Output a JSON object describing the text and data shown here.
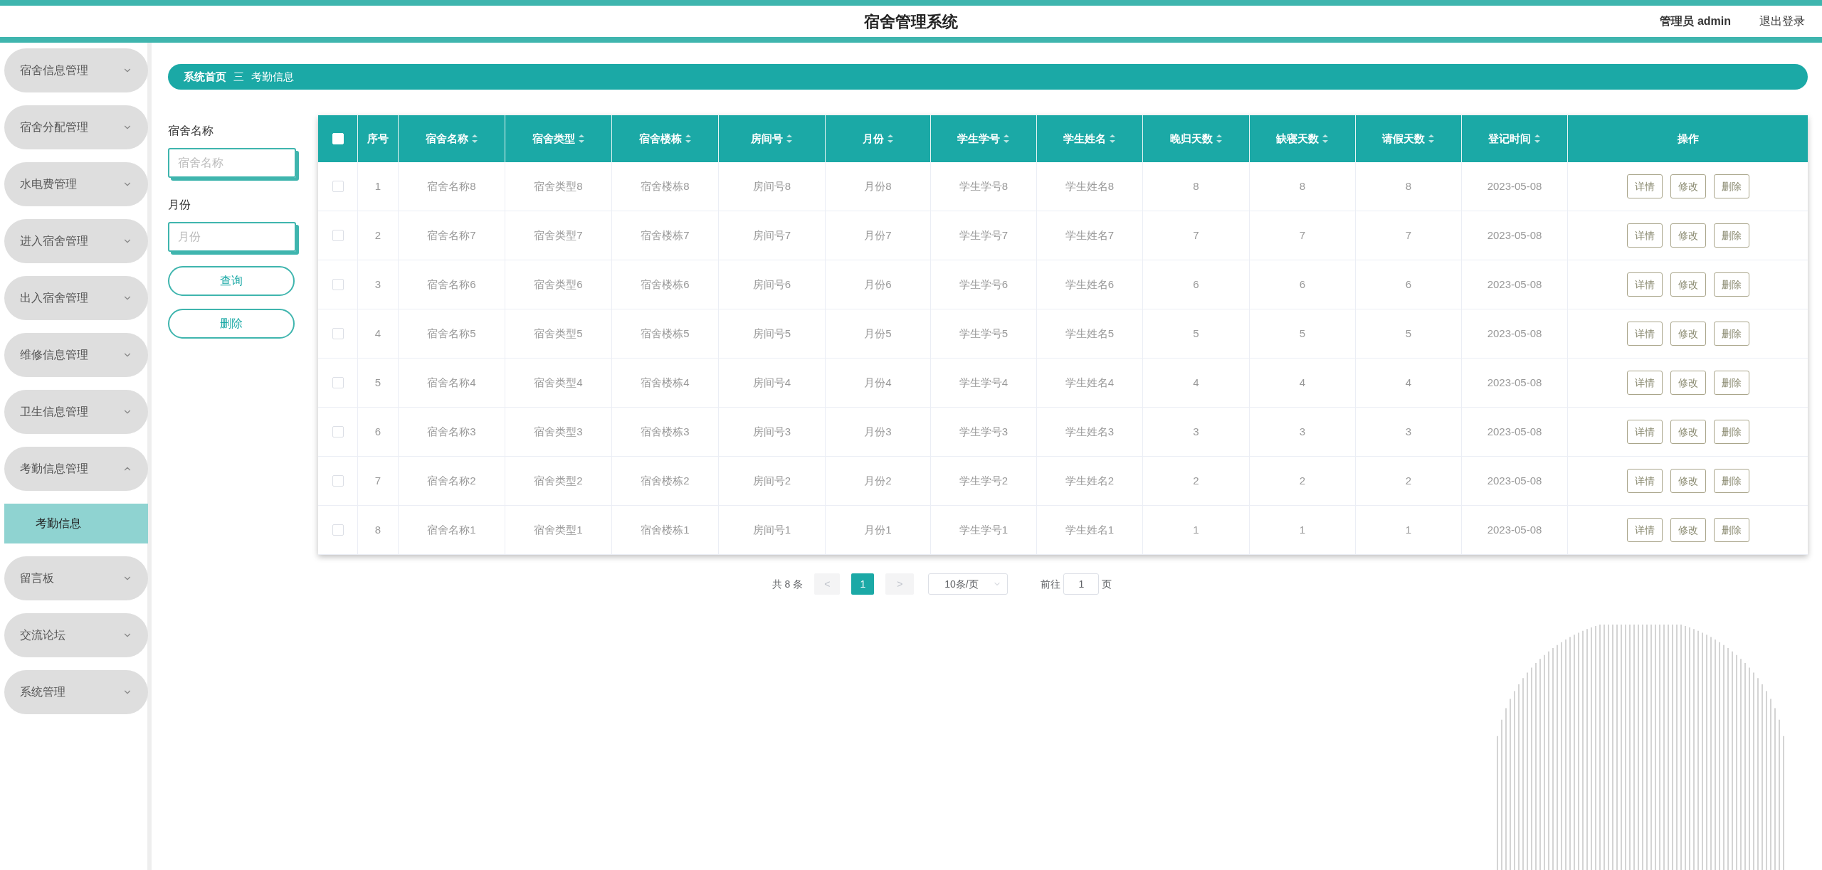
{
  "header": {
    "title": "宿舍管理系统",
    "user": "管理员 admin",
    "logout": "退出登录"
  },
  "sidebar": {
    "items": [
      {
        "label": "宿舍信息管理",
        "expanded": false
      },
      {
        "label": "宿舍分配管理",
        "expanded": false
      },
      {
        "label": "水电费管理",
        "expanded": false
      },
      {
        "label": "进入宿舍管理",
        "expanded": false
      },
      {
        "label": "出入宿舍管理",
        "expanded": false
      },
      {
        "label": "维修信息管理",
        "expanded": false
      },
      {
        "label": "卫生信息管理",
        "expanded": false
      },
      {
        "label": "考勤信息管理",
        "expanded": true,
        "children": [
          {
            "label": "考勤信息",
            "selected": true
          }
        ]
      },
      {
        "label": "留言板",
        "expanded": false
      },
      {
        "label": "交流论坛",
        "expanded": false
      },
      {
        "label": "系统管理",
        "expanded": false
      }
    ]
  },
  "breadcrumb": [
    "系统首页",
    "考勤信息"
  ],
  "breadcrumb_separator": "三",
  "search": {
    "fields": [
      {
        "label": "宿舍名称",
        "placeholder": "宿舍名称"
      },
      {
        "label": "月份",
        "placeholder": "月份"
      }
    ],
    "buttons": [
      "查询",
      "删除"
    ]
  },
  "table": {
    "select_all_checked": false,
    "columns": [
      {
        "label": "序号",
        "sortable": false
      },
      {
        "label": "宿舍名称",
        "sortable": true
      },
      {
        "label": "宿舍类型",
        "sortable": true
      },
      {
        "label": "宿舍楼栋",
        "sortable": true
      },
      {
        "label": "房间号",
        "sortable": true
      },
      {
        "label": "月份",
        "sortable": true
      },
      {
        "label": "学生学号",
        "sortable": true
      },
      {
        "label": "学生姓名",
        "sortable": true
      },
      {
        "label": "晚归天数",
        "sortable": true
      },
      {
        "label": "缺寝天数",
        "sortable": true
      },
      {
        "label": "请假天数",
        "sortable": true
      },
      {
        "label": "登记时间",
        "sortable": true
      },
      {
        "label": "操作",
        "sortable": false
      }
    ],
    "rows": [
      {
        "checked": false,
        "cells": [
          "1",
          "宿舍名称8",
          "宿舍类型8",
          "宿舍楼栋8",
          "房间号8",
          "月份8",
          "学生学号8",
          "学生姓名8",
          "8",
          "8",
          "8",
          "2023-05-08"
        ],
        "actions": [
          "详情",
          "修改",
          "删除"
        ]
      },
      {
        "checked": false,
        "cells": [
          "2",
          "宿舍名称7",
          "宿舍类型7",
          "宿舍楼栋7",
          "房间号7",
          "月份7",
          "学生学号7",
          "学生姓名7",
          "7",
          "7",
          "7",
          "2023-05-08"
        ],
        "actions": [
          "详情",
          "修改",
          "删除"
        ]
      },
      {
        "checked": false,
        "cells": [
          "3",
          "宿舍名称6",
          "宿舍类型6",
          "宿舍楼栋6",
          "房间号6",
          "月份6",
          "学生学号6",
          "学生姓名6",
          "6",
          "6",
          "6",
          "2023-05-08"
        ],
        "actions": [
          "详情",
          "修改",
          "删除"
        ]
      },
      {
        "checked": false,
        "cells": [
          "4",
          "宿舍名称5",
          "宿舍类型5",
          "宿舍楼栋5",
          "房间号5",
          "月份5",
          "学生学号5",
          "学生姓名5",
          "5",
          "5",
          "5",
          "2023-05-08"
        ],
        "actions": [
          "详情",
          "修改",
          "删除"
        ]
      },
      {
        "checked": false,
        "cells": [
          "5",
          "宿舍名称4",
          "宿舍类型4",
          "宿舍楼栋4",
          "房间号4",
          "月份4",
          "学生学号4",
          "学生姓名4",
          "4",
          "4",
          "4",
          "2023-05-08"
        ],
        "actions": [
          "详情",
          "修改",
          "删除"
        ]
      },
      {
        "checked": false,
        "cells": [
          "6",
          "宿舍名称3",
          "宿舍类型3",
          "宿舍楼栋3",
          "房间号3",
          "月份3",
          "学生学号3",
          "学生姓名3",
          "3",
          "3",
          "3",
          "2023-05-08"
        ],
        "actions": [
          "详情",
          "修改",
          "删除"
        ]
      },
      {
        "checked": false,
        "cells": [
          "7",
          "宿舍名称2",
          "宿舍类型2",
          "宿舍楼栋2",
          "房间号2",
          "月份2",
          "学生学号2",
          "学生姓名2",
          "2",
          "2",
          "2",
          "2023-05-08"
        ],
        "actions": [
          "详情",
          "修改",
          "删除"
        ]
      },
      {
        "checked": false,
        "cells": [
          "8",
          "宿舍名称1",
          "宿舍类型1",
          "宿舍楼栋1",
          "房间号1",
          "月份1",
          "学生学号1",
          "学生姓名1",
          "1",
          "1",
          "1",
          "2023-05-08"
        ],
        "actions": [
          "详情",
          "修改",
          "删除"
        ]
      }
    ]
  },
  "pagination": {
    "total": "共 8 条",
    "prev": "<",
    "pages": [
      {
        "label": "1",
        "selected": true
      }
    ],
    "next": ">",
    "page_size": "10条/页",
    "goto_label": "前往",
    "goto_value": "1",
    "goto_suffix": "页"
  }
}
